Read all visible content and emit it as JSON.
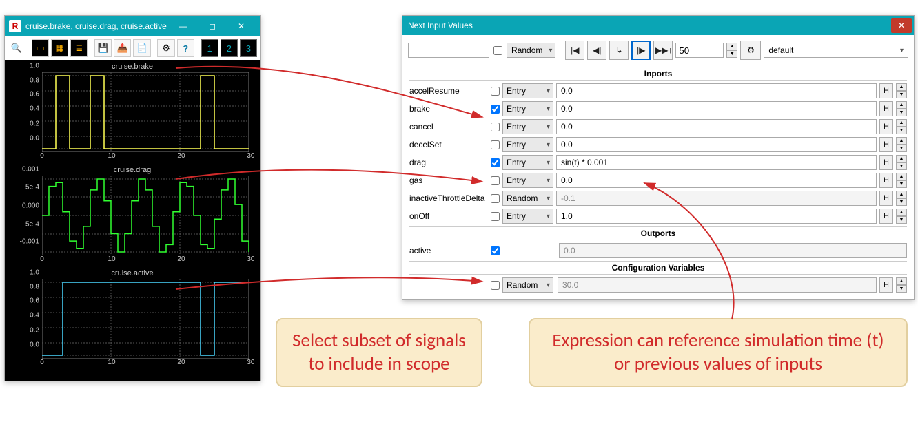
{
  "scope": {
    "title": "cruise.brake, cruise.drag, cruise.active",
    "app_icon_letter": "R",
    "toolbar_nums": [
      "1",
      "2",
      "3"
    ],
    "charts": [
      {
        "title": "cruise.brake",
        "color": "#ffff55",
        "y_ticks": [
          "1.0",
          "0.8",
          "0.6",
          "0.4",
          "0.2",
          "0.0"
        ],
        "x_ticks": [
          "0",
          "10",
          "20",
          "30"
        ]
      },
      {
        "title": "cruise.drag",
        "color": "#30ff30",
        "y_ticks": [
          "0.001",
          "5e-4",
          "0.000",
          "-5e-4",
          "-0.001"
        ],
        "x_ticks": [
          "0",
          "10",
          "20",
          "30"
        ]
      },
      {
        "title": "cruise.active",
        "color": "#4ad7ff",
        "y_ticks": [
          "1.0",
          "0.8",
          "0.6",
          "0.4",
          "0.2",
          "0.0"
        ],
        "x_ticks": [
          "0",
          "10",
          "20",
          "30"
        ]
      }
    ]
  },
  "niv": {
    "title": "Next Input Values",
    "toolbar_mode": "Random",
    "step_count": "50",
    "org": "default",
    "section_inports": "Inports",
    "section_outports": "Outports",
    "section_config": "Configuration Variables",
    "inports": [
      {
        "name": "accelResume",
        "checked": false,
        "mode": "Entry",
        "value": "0.0",
        "readonly": false
      },
      {
        "name": "brake",
        "checked": true,
        "mode": "Entry",
        "value": "0.0",
        "readonly": false
      },
      {
        "name": "cancel",
        "checked": false,
        "mode": "Entry",
        "value": "0.0",
        "readonly": false
      },
      {
        "name": "decelSet",
        "checked": false,
        "mode": "Entry",
        "value": "0.0",
        "readonly": false
      },
      {
        "name": "drag",
        "checked": true,
        "mode": "Entry",
        "value": "sin(t) * 0.001",
        "readonly": false
      },
      {
        "name": "gas",
        "checked": false,
        "mode": "Entry",
        "value": "0.0",
        "readonly": false
      },
      {
        "name": "inactiveThrottleDelta",
        "checked": false,
        "mode": "Random",
        "value": "-0.1",
        "readonly": true
      },
      {
        "name": "onOff",
        "checked": false,
        "mode": "Entry",
        "value": "1.0",
        "readonly": false
      }
    ],
    "outports": [
      {
        "name": "active",
        "checked": true,
        "value": "0.0"
      }
    ],
    "config": [
      {
        "checked": false,
        "mode": "Random",
        "value": "30.0"
      }
    ]
  },
  "callouts": {
    "left": "Select subset of signals to include in scope",
    "right": "Expression can reference simulation time (t) or previous values of inputs"
  },
  "chart_data": [
    {
      "type": "line",
      "title": "cruise.brake",
      "xlabel": "",
      "ylabel": "",
      "xlim": [
        0,
        30
      ],
      "ylim": [
        0,
        1
      ],
      "x": [
        0,
        2,
        2,
        4,
        4,
        7,
        7,
        9,
        9,
        23,
        23,
        25,
        25,
        30
      ],
      "values": [
        0,
        0,
        1,
        1,
        0,
        0,
        1,
        1,
        0,
        0,
        1,
        1,
        0,
        0
      ]
    },
    {
      "type": "line",
      "title": "cruise.drag",
      "xlabel": "",
      "ylabel": "",
      "xlim": [
        0,
        30
      ],
      "ylim": [
        -0.001,
        0.001
      ],
      "x": [
        0,
        1,
        2,
        3,
        4,
        5,
        6,
        7,
        8,
        9,
        10,
        11,
        12,
        13,
        14,
        15,
        16,
        17,
        18,
        19,
        20,
        21,
        22,
        23,
        24,
        25,
        26,
        27,
        28,
        29,
        30
      ],
      "values": [
        0.0,
        0.0008,
        0.0009,
        0.0001,
        -0.0007,
        -0.0009,
        -0.0003,
        0.0007,
        0.001,
        0.0004,
        -0.0005,
        -0.001,
        -0.0005,
        0.0004,
        0.001,
        0.0007,
        -0.0003,
        -0.001,
        -0.0008,
        0.0001,
        0.0009,
        0.0008,
        0.0,
        -0.0008,
        -0.0009,
        -0.0001,
        0.0007,
        0.001,
        0.0003,
        -0.0007,
        -0.001
      ]
    },
    {
      "type": "line",
      "title": "cruise.active",
      "xlabel": "",
      "ylabel": "",
      "xlim": [
        0,
        30
      ],
      "ylim": [
        0,
        1
      ],
      "x": [
        0,
        3,
        3,
        23,
        23,
        25,
        25,
        30
      ],
      "values": [
        0,
        0,
        1,
        1,
        0,
        0,
        1,
        1
      ]
    }
  ]
}
